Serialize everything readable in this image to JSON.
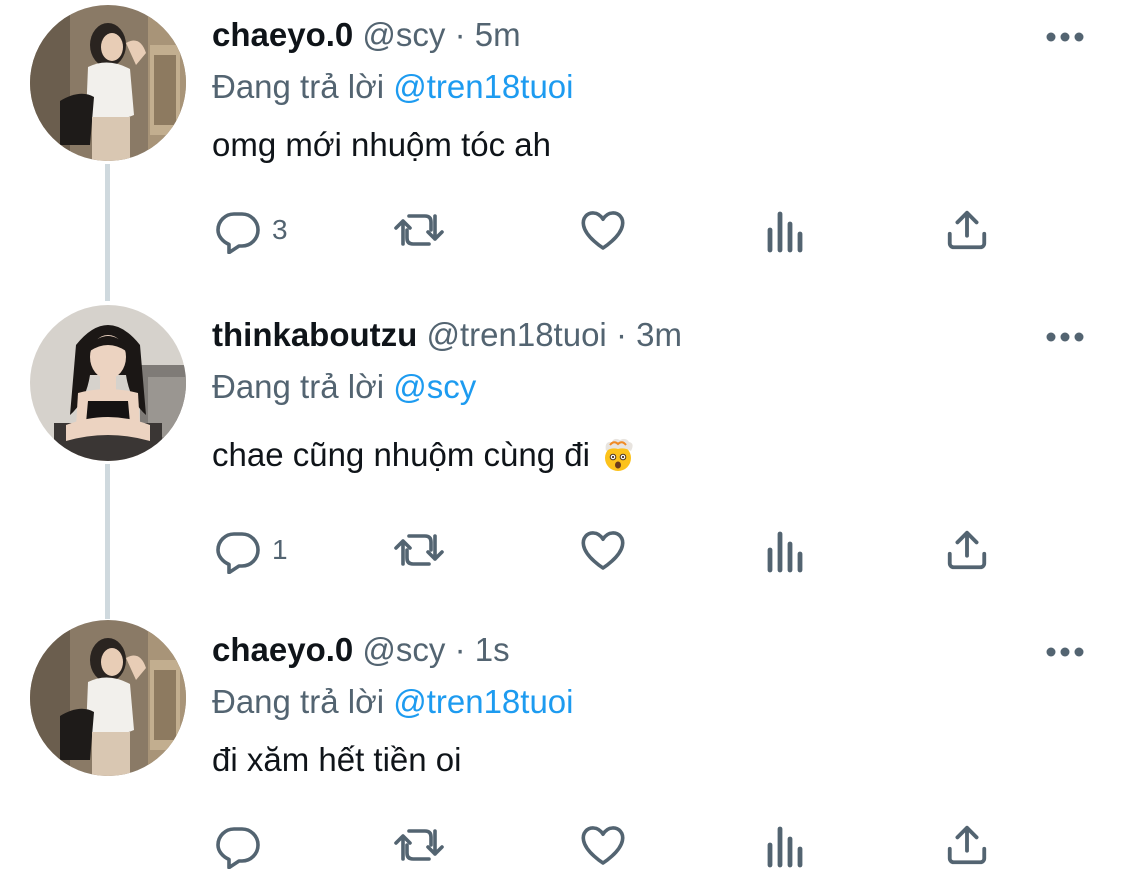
{
  "colors": {
    "text_primary": "#0f1419",
    "text_secondary": "#536471",
    "link": "#1d9bf0",
    "thread_line": "#cfd9de"
  },
  "icons": {
    "reply": "reply-icon",
    "retweet": "retweet-icon",
    "like": "heart-icon",
    "views": "views-icon",
    "share": "share-icon",
    "more": "more-icon"
  },
  "tweets": [
    {
      "display_name": "chaeyo.0",
      "handle": "@scy",
      "separator": "·",
      "time": "5m",
      "reply_prefix": "Đang trả lời",
      "reply_to": "@tren18tuoi",
      "text": "omg mới nhuộm tóc ah",
      "emoji": "",
      "reply_count": "3"
    },
    {
      "display_name": "thinkaboutzu",
      "handle": "@tren18tuoi",
      "separator": "·",
      "time": "3m",
      "reply_prefix": "Đang trả lời",
      "reply_to": "@scy",
      "text": "chae cũng nhuộm cùng đi",
      "emoji": "exploding-head",
      "reply_count": "1"
    },
    {
      "display_name": "chaeyo.0",
      "handle": "@scy",
      "separator": "·",
      "time": "1s",
      "reply_prefix": "Đang trả lời",
      "reply_to": "@tren18tuoi",
      "text": "đi xăm hết tiền oi",
      "emoji": "",
      "reply_count": ""
    }
  ]
}
